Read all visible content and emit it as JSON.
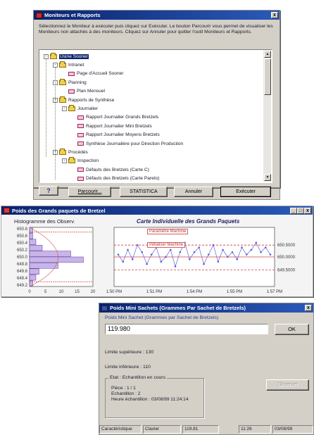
{
  "win1": {
    "title": "Moniteurs et Rapports",
    "close": "x",
    "instructions": "Sélectionnez le Moniteur à exécuter puis cliquez sur Exécuter.  Le bouton Parcourir vous permet de visualiser les Moniteurs non attachés à des moniteurs.  Cliquez sur Annuler pour quitter l'outil Moniteurs et Rapports.",
    "tree": [
      {
        "label": "Usine Sooner",
        "kind": "folder",
        "level": 0,
        "pm": "-",
        "selected": true
      },
      {
        "label": "Intranet",
        "kind": "folder",
        "level": 1,
        "pm": "-"
      },
      {
        "label": "Page d'Accueil Sooner",
        "kind": "page",
        "level": 2
      },
      {
        "label": "Planning",
        "kind": "folder",
        "level": 1,
        "pm": "-"
      },
      {
        "label": "Plan Mensuel",
        "kind": "page",
        "level": 2
      },
      {
        "label": "Rapports de Synthèse",
        "kind": "folder",
        "level": 1,
        "pm": "-"
      },
      {
        "label": "Journalier",
        "kind": "folder",
        "level": 2,
        "pm": "-"
      },
      {
        "label": "Rapport Journalier Grands Bretzels",
        "kind": "page",
        "level": 3
      },
      {
        "label": "Rapport Journalier Mini Bretzels",
        "kind": "page",
        "level": 3
      },
      {
        "label": "Rapport Journalier Moyens Bretzels",
        "kind": "page",
        "level": 3
      },
      {
        "label": "Synthèse Journalière pour Direction Production",
        "kind": "page",
        "level": 3
      },
      {
        "label": "Procédés",
        "kind": "folder",
        "level": 1,
        "pm": "-"
      },
      {
        "label": "Inspection",
        "kind": "folder",
        "level": 2,
        "pm": "-"
      },
      {
        "label": "Défauts des Bretzels (Carte C)",
        "kind": "page",
        "level": 3
      },
      {
        "label": "Défauts des Bretzels (Carte Pareto)",
        "kind": "page",
        "level": 3
      }
    ],
    "buttons": {
      "help": "?",
      "browse": "Parcourir...",
      "statistica": "STATISTICA",
      "cancel": "Annuler",
      "run": "Exécuter"
    }
  },
  "win2": {
    "title": "Poids des Grands paquets de Bretzel",
    "controls": [
      "_",
      "□",
      "x"
    ],
    "hist_title": "Histogramme des Observ.",
    "chart_title": "Carte Individuelle des Grands Paquets",
    "flag_params": "Paramètre Machine",
    "flag_init": "Initialiser Machine",
    "hist_yticks": [
      "650.8",
      "650.6",
      "650.4",
      "650.2",
      "650.0",
      "649.8",
      "649.6",
      "649.4",
      "649.2"
    ],
    "hist_xticks": [
      "0",
      "5",
      "10",
      "15",
      "20"
    ],
    "chart_xticks": [
      "1:50 PM",
      "1:51 PM",
      "1:54 PM",
      "1:55 PM",
      "1:57 PM"
    ],
    "chart_yticks": [
      "650.5000",
      "650.0000",
      "649.5000"
    ],
    "hist_counts": [
      1,
      1,
      2,
      4,
      13,
      17,
      9,
      3,
      2,
      1
    ],
    "series_color": "#6060d8",
    "limit_color": "#d83c3c",
    "center_color": "#d04040"
  },
  "win3": {
    "title": "Poids Mini Sachets (Grammes Par Sachet de Bretzels)",
    "close": "x",
    "subtitle": "Poids Mini Sachet (Grammes par Sachet de Bretzels)",
    "value": "119.980",
    "ok": "OK",
    "upper": "Limite supérieure : 130",
    "lower": "Limite inférieure : 110",
    "group": "Etat : Echantillon en cours",
    "piece": "Pièce : 1  /  1",
    "sample": "Echantillon : 2",
    "time": "Heure échantillon : 03/08/99 11:24:14",
    "disabled_btn": "Observer",
    "status": [
      "Caractéristique",
      "Clavier",
      "119.81",
      "11:26",
      "03/08/99"
    ]
  }
}
